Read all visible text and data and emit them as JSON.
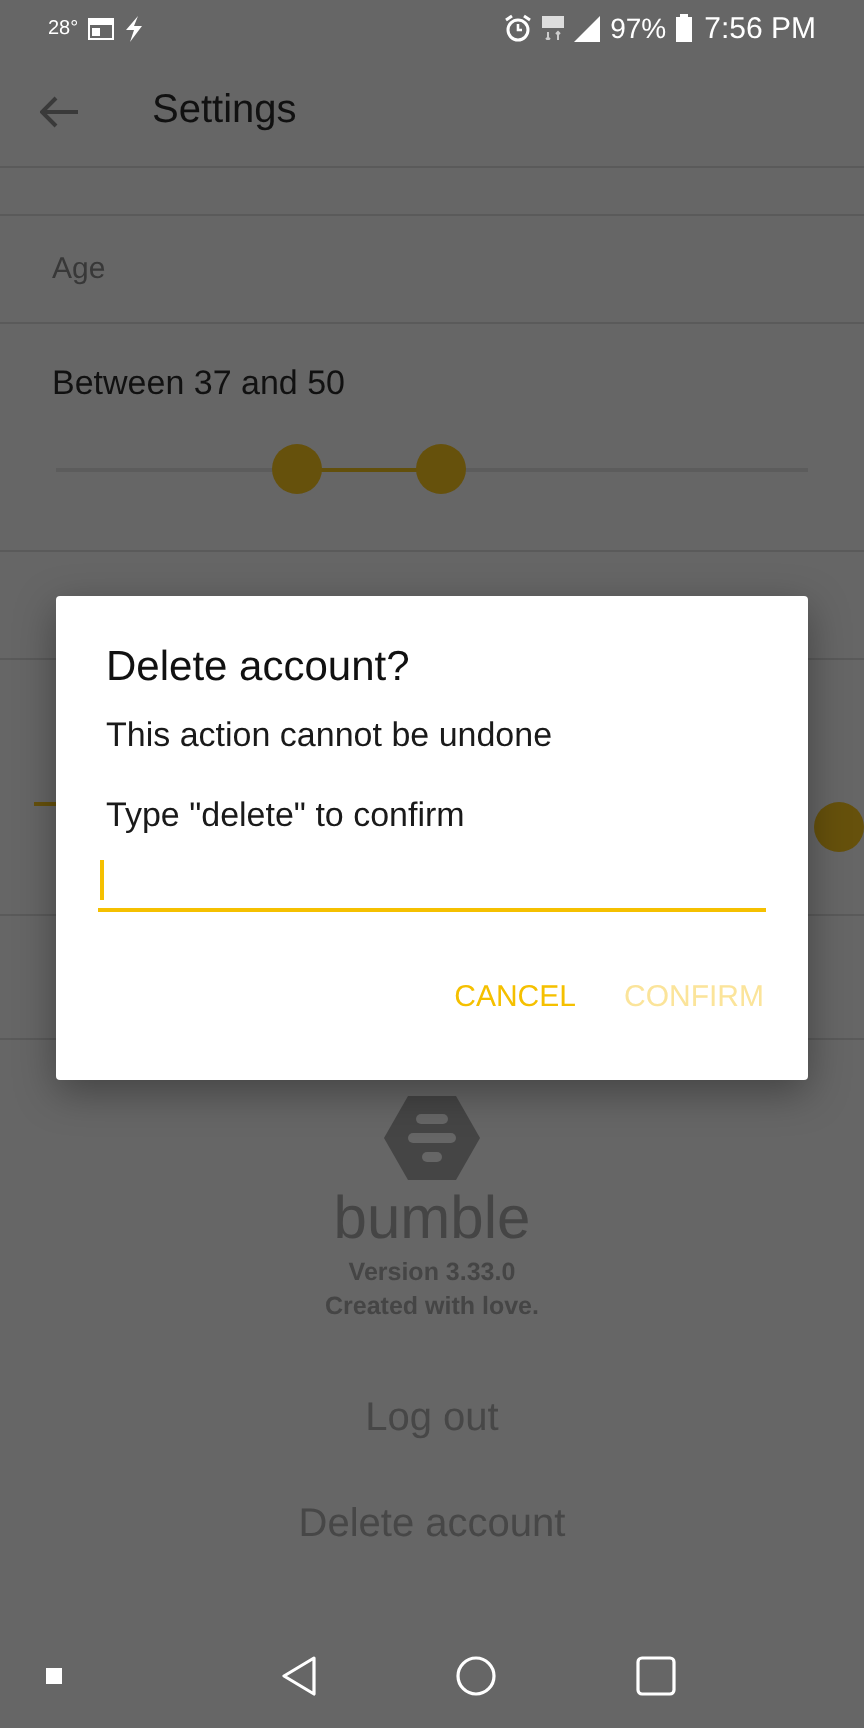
{
  "status_bar": {
    "temperature": "28°",
    "battery_percent": "97%",
    "time": "7:56 PM"
  },
  "toolbar": {
    "title": "Settings"
  },
  "age_section": {
    "header": "Age",
    "range_label": "Between 37 and 50",
    "slider": {
      "thumbs": [
        {
          "level": 0.32
        },
        {
          "level": 0.51
        }
      ]
    }
  },
  "covered_slider": {
    "level": 0.96
  },
  "about": {
    "brand": "bumble",
    "version": "Version 3.33.0",
    "tagline": "Created with love."
  },
  "actions": [
    "Log out",
    "Delete account"
  ],
  "dialog": {
    "title": "Delete account?",
    "message": "This action cannot be undone",
    "prompt": "Type \"delete\" to confirm",
    "field": {
      "focused": true
    },
    "buttons": [
      {
        "label": "CANCEL",
        "disabled": false
      },
      {
        "label": "CONFIRM",
        "disabled": true
      }
    ]
  }
}
